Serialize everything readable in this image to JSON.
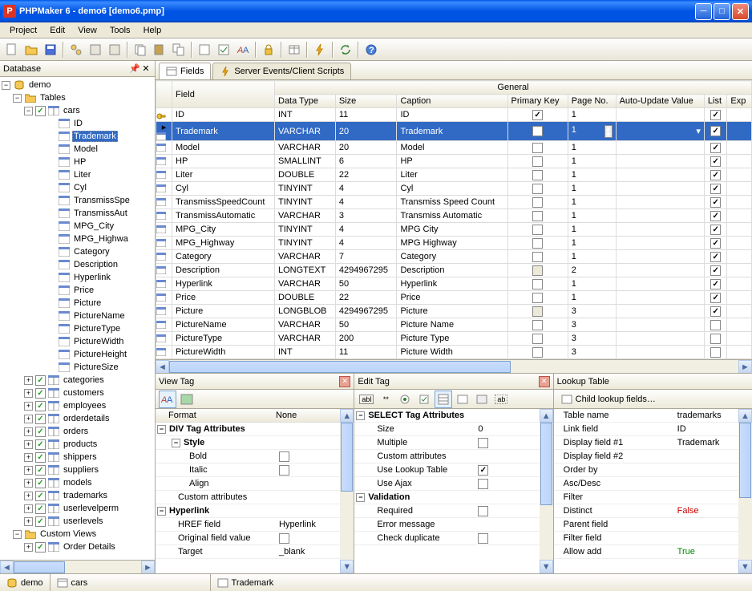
{
  "window": {
    "title": "PHPMaker 6 - demo6 [demo6.pmp]"
  },
  "menu": [
    "Project",
    "Edit",
    "View",
    "Tools",
    "Help"
  ],
  "sidebar": {
    "title": "Database",
    "root": "demo",
    "tables_label": "Tables",
    "selected_table": "cars",
    "selected_field": "Trademark",
    "fields": [
      "ID",
      "Trademark",
      "Model",
      "HP",
      "Liter",
      "Cyl",
      "TransmissSpe",
      "TransmissAut",
      "MPG_City",
      "MPG_Highwa",
      "Category",
      "Description",
      "Hyperlink",
      "Price",
      "Picture",
      "PictureName",
      "PictureType",
      "PictureWidth",
      "PictureHeight",
      "PictureSize"
    ],
    "tables": [
      "categories",
      "customers",
      "employees",
      "orderdetails",
      "orders",
      "products",
      "shippers",
      "suppliers",
      "models",
      "trademarks",
      "userlevelperm",
      "userlevels"
    ],
    "custom_views": "Custom Views",
    "order_details": "Order Details"
  },
  "tabs": {
    "fields": "Fields",
    "scripts": "Server Events/Client Scripts"
  },
  "grid": {
    "header_field": "Field",
    "header_general": "General",
    "cols": [
      "Field Name",
      "Data Type",
      "Size",
      "Caption",
      "Primary Key",
      "Page No.",
      "Auto-Update Value",
      "List",
      "Exp"
    ],
    "rows": [
      {
        "name": "ID",
        "type": "INT",
        "size": "11",
        "caption": "ID",
        "pk": true,
        "page": "1",
        "list": true,
        "key": true
      },
      {
        "name": "Trademark",
        "type": "VARCHAR",
        "size": "20",
        "caption": "Trademark",
        "pk": false,
        "page": "1",
        "list": true,
        "selected": true,
        "spinner": true
      },
      {
        "name": "Model",
        "type": "VARCHAR",
        "size": "20",
        "caption": "Model",
        "pk": false,
        "page": "1",
        "list": true
      },
      {
        "name": "HP",
        "type": "SMALLINT",
        "size": "6",
        "caption": "HP",
        "pk": false,
        "page": "1",
        "list": true
      },
      {
        "name": "Liter",
        "type": "DOUBLE",
        "size": "22",
        "caption": "Liter",
        "pk": false,
        "page": "1",
        "list": true
      },
      {
        "name": "Cyl",
        "type": "TINYINT",
        "size": "4",
        "caption": "Cyl",
        "pk": false,
        "page": "1",
        "list": true
      },
      {
        "name": "TransmissSpeedCount",
        "type": "TINYINT",
        "size": "4",
        "caption": "Transmiss Speed Count",
        "pk": false,
        "page": "1",
        "list": true
      },
      {
        "name": "TransmissAutomatic",
        "type": "VARCHAR",
        "size": "3",
        "caption": "Transmiss Automatic",
        "pk": false,
        "page": "1",
        "list": true
      },
      {
        "name": "MPG_City",
        "type": "TINYINT",
        "size": "4",
        "caption": "MPG City",
        "pk": false,
        "page": "1",
        "list": true
      },
      {
        "name": "MPG_Highway",
        "type": "TINYINT",
        "size": "4",
        "caption": "MPG Highway",
        "pk": false,
        "page": "1",
        "list": true
      },
      {
        "name": "Category",
        "type": "VARCHAR",
        "size": "7",
        "caption": "Category",
        "pk": false,
        "page": "1",
        "list": true
      },
      {
        "name": "Description",
        "type": "LONGTEXT",
        "size": "4294967295",
        "caption": "Description",
        "pk": false,
        "page": "2",
        "list": true,
        "graypk": true
      },
      {
        "name": "Hyperlink",
        "type": "VARCHAR",
        "size": "50",
        "caption": "Hyperlink",
        "pk": false,
        "page": "1",
        "list": true
      },
      {
        "name": "Price",
        "type": "DOUBLE",
        "size": "22",
        "caption": "Price",
        "pk": false,
        "page": "1",
        "list": true
      },
      {
        "name": "Picture",
        "type": "LONGBLOB",
        "size": "4294967295",
        "caption": "Picture",
        "pk": false,
        "page": "3",
        "list": true,
        "graypk": true
      },
      {
        "name": "PictureName",
        "type": "VARCHAR",
        "size": "50",
        "caption": "Picture Name",
        "pk": false,
        "page": "3",
        "list": false
      },
      {
        "name": "PictureType",
        "type": "VARCHAR",
        "size": "200",
        "caption": "Picture Type",
        "pk": false,
        "page": "3",
        "list": false
      },
      {
        "name": "PictureWidth",
        "type": "INT",
        "size": "11",
        "caption": "Picture Width",
        "pk": false,
        "page": "3",
        "list": false
      }
    ]
  },
  "viewtag": {
    "title": "View Tag",
    "format_label": "Format",
    "format_value": "None",
    "div_header": "DIV Tag Attributes",
    "style": "Style",
    "bold": "Bold",
    "italic": "Italic",
    "align": "Align",
    "custom": "Custom attributes",
    "hyperlink": "Hyperlink",
    "href": "HREF field",
    "href_v": "Hyperlink",
    "orig": "Original field value",
    "target": "Target",
    "target_v": "_blank"
  },
  "edittag": {
    "title": "Edit Tag",
    "select_header": "SELECT Tag Attributes",
    "size": "Size",
    "size_v": "0",
    "multiple": "Multiple",
    "custom": "Custom attributes",
    "use_lookup": "Use Lookup Table",
    "use_ajax": "Use Ajax",
    "validation": "Validation",
    "required": "Required",
    "errmsg": "Error message",
    "checkdup": "Check duplicate"
  },
  "lookup": {
    "title": "Lookup Table",
    "child": "Child lookup fields…",
    "table_name": "Table name",
    "table_name_v": "trademarks",
    "link_field": "Link field",
    "link_field_v": "ID",
    "disp1": "Display field #1",
    "disp1_v": "Trademark",
    "disp2": "Display field #2",
    "orderby": "Order by",
    "ascdesc": "Asc/Desc",
    "filter": "Filter",
    "distinct": "Distinct",
    "distinct_v": "False",
    "parent": "Parent field",
    "filter_field": "Filter field",
    "allow_add": "Allow add",
    "allow_add_v": "True"
  },
  "status": {
    "db": "demo",
    "table": "cars",
    "field": "Trademark"
  }
}
